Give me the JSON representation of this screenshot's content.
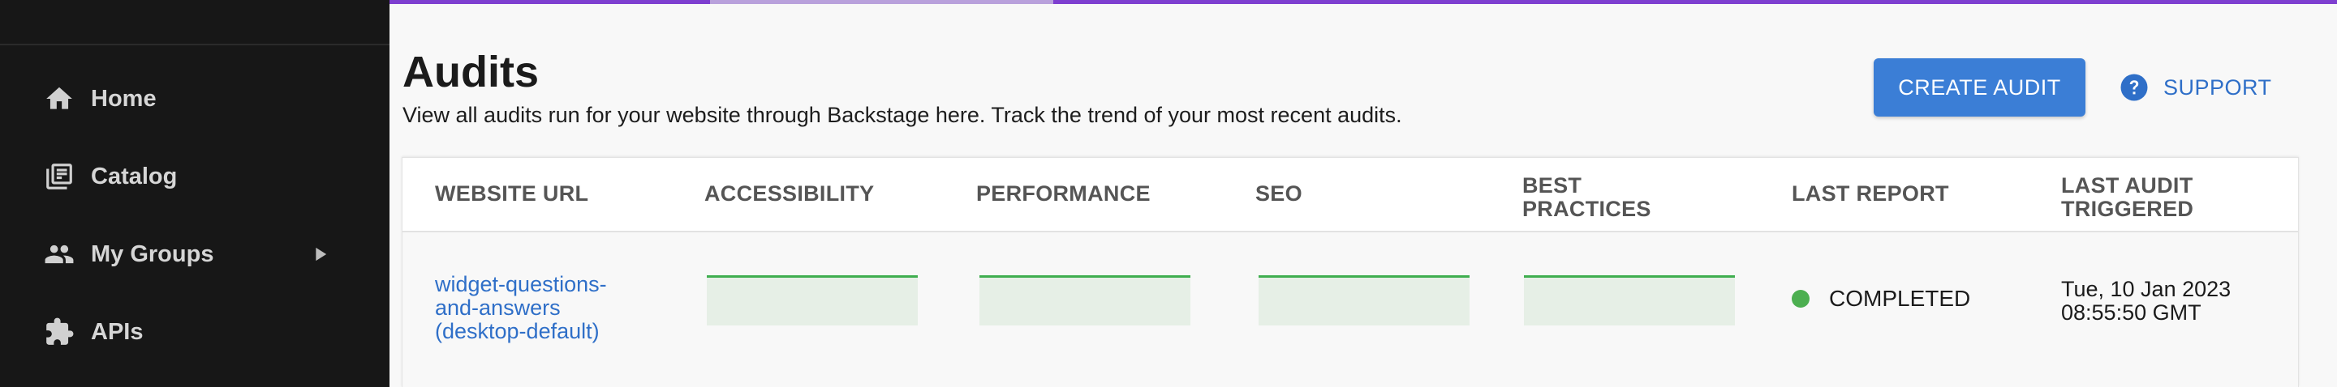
{
  "sidebar": {
    "items": [
      {
        "label": "Home",
        "icon": "home-icon"
      },
      {
        "label": "Catalog",
        "icon": "catalog-icon"
      },
      {
        "label": "My Groups",
        "icon": "groups-icon",
        "has_submenu": true
      },
      {
        "label": "APIs",
        "icon": "puzzle-icon"
      }
    ]
  },
  "header": {
    "title": "Audits",
    "subtitle": "View all audits run for your website through Backstage here. Track the trend of your most recent audits.",
    "create_button": "CREATE AUDIT",
    "support_button": "SUPPORT"
  },
  "table": {
    "columns": [
      "WEBSITE URL",
      "ACCESSIBILITY",
      "PERFORMANCE",
      "SEO",
      "BEST PRACTICES",
      "LAST REPORT",
      "LAST AUDIT TRIGGERED"
    ],
    "rows": [
      {
        "website_url": "widget-questions-and-answers (desktop-default)",
        "last_report": "COMPLETED",
        "last_audit_triggered": "Tue, 10 Jan 2023 08:55:50 GMT"
      }
    ]
  },
  "colors": {
    "sidebar_bg": "#171717",
    "accent": "#3b7ed6",
    "progress": "#7e3fd0",
    "status_completed": "#4caf50",
    "sparkline": "#3fae4f"
  }
}
